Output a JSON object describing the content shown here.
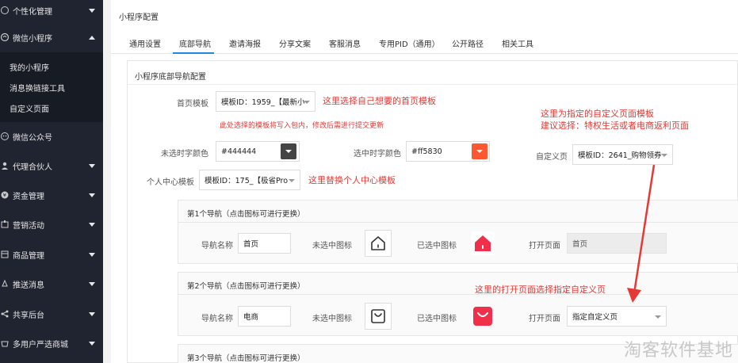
{
  "sidebar": {
    "items": [
      {
        "label": "个性化管理",
        "icon": "palette-icon",
        "expanded": false
      },
      {
        "label": "微信小程序",
        "icon": "miniprogram-icon",
        "expanded": true
      },
      {
        "label": "微信公众号",
        "icon": "wechat-icon",
        "expanded": false
      },
      {
        "label": "代理合伙人",
        "icon": "partner-icon",
        "expanded": false
      },
      {
        "label": "资金管理",
        "icon": "money-icon",
        "expanded": false
      },
      {
        "label": "营销活动",
        "icon": "marketing-icon",
        "expanded": false
      },
      {
        "label": "商品管理",
        "icon": "goods-icon",
        "expanded": false
      },
      {
        "label": "推送消息",
        "icon": "push-icon",
        "expanded": false
      },
      {
        "label": "共享后台",
        "icon": "share-icon",
        "expanded": false
      },
      {
        "label": "多用户严选商城",
        "icon": "mall-icon",
        "expanded": false
      }
    ],
    "subitems": [
      "我的小程序",
      "消息换链接工具",
      "自定义页面"
    ]
  },
  "main": {
    "page_title": "小程序配置",
    "tabs": [
      "通用设置",
      "底部导航",
      "邀请海报",
      "分享文案",
      "客服消息",
      "专用PID（通用）",
      "公开路径",
      "相关工具"
    ],
    "active_tab": "底部导航",
    "panel_title": "小程序底部导航配置",
    "homepage": {
      "label": "首页模板",
      "value": "模板ID：1959_【最新小",
      "annotation": "这里选择自己想要的首页模板",
      "warning": "此处选择的模板将写入包内，修改后需进行提交更新"
    },
    "custom_annotation": [
      "这里为指定的自定义页面模板",
      "建议选择：特权生活或者电商返利页面"
    ],
    "unselected_color": {
      "label": "未选时字颜色",
      "value": "#444444",
      "color": "#444444"
    },
    "selected_color": {
      "label": "选中时字颜色",
      "value": "#ff5830",
      "color": "#ff5830"
    },
    "custom_page": {
      "label": "自定义页",
      "value": "模板ID：2641_购物领券"
    },
    "profile_template": {
      "label": "个人中心模板",
      "value": "模板ID：175_【极省Pro",
      "annotation": "这里替换个人中心模板"
    },
    "navs": [
      {
        "title": "第1个导航（点击图标可进行更换）",
        "name_label": "导航名称",
        "name_value": "首页",
        "unselected_label": "未选中图标",
        "selected_label": "已选中图标",
        "open_label": "打开页面",
        "open_value": "首页",
        "icon": "home-icon"
      },
      {
        "title": "第2个导航（点击图标可进行更换）",
        "name_label": "导航名称",
        "name_value": "电商",
        "unselected_label": "未选中图标",
        "selected_label": "已选中图标",
        "open_label": "打开页面",
        "open_value": "指定自定义页",
        "icon": "shopping-bag-icon",
        "annotation": "这里的打开页面选择指定自定义页"
      },
      {
        "title": "第3个导航（点击图标可进行更换）"
      }
    ],
    "accent_red": "#e53935",
    "icon_red": "#f0304a"
  },
  "watermark": "淘客软件基地"
}
